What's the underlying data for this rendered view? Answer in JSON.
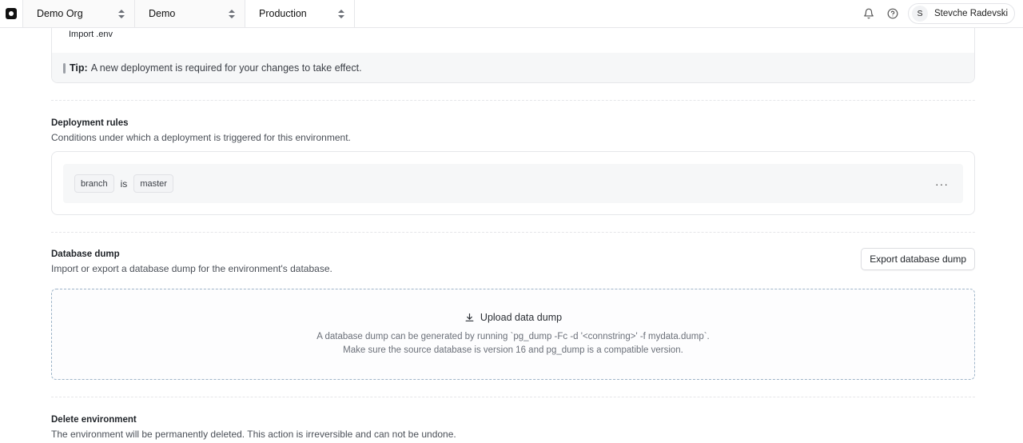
{
  "topbar": {
    "org": "Demo Org",
    "project": "Demo",
    "environment": "Production",
    "user_initial": "S",
    "user_name": "Stevche Radevski",
    "icons": [
      "logo-icon",
      "bell-icon",
      "help-icon"
    ]
  },
  "env_vars": {
    "import_label": "Import .env",
    "tip_label": "Tip:",
    "tip_text": "A new deployment is required for your changes to take effect."
  },
  "deployment_rules": {
    "title": "Deployment rules",
    "description": "Conditions under which a deployment is triggered for this environment.",
    "rule": {
      "field": "branch",
      "operator": "is",
      "value": "master"
    },
    "more_label": "···"
  },
  "database_dump": {
    "title": "Database dump",
    "description": "Import or export a database dump for the environment's database.",
    "export_label": "Export database dump",
    "upload_label": "Upload data dump",
    "hint_line1": "A database dump can be generated by running `pg_dump -Fc -d '<connstring>' -f mydata.dump`.",
    "hint_line2": "Make sure the source database is version 16 and pg_dump is a compatible version."
  },
  "delete_environment": {
    "title": "Delete environment",
    "description": "The environment will be permanently deleted. This action is irreversible and can not be undone."
  },
  "colors": {
    "border": "#e6e7ea",
    "muted_bg": "#f6f7f8",
    "dropzone_border": "#9fb5c9"
  }
}
